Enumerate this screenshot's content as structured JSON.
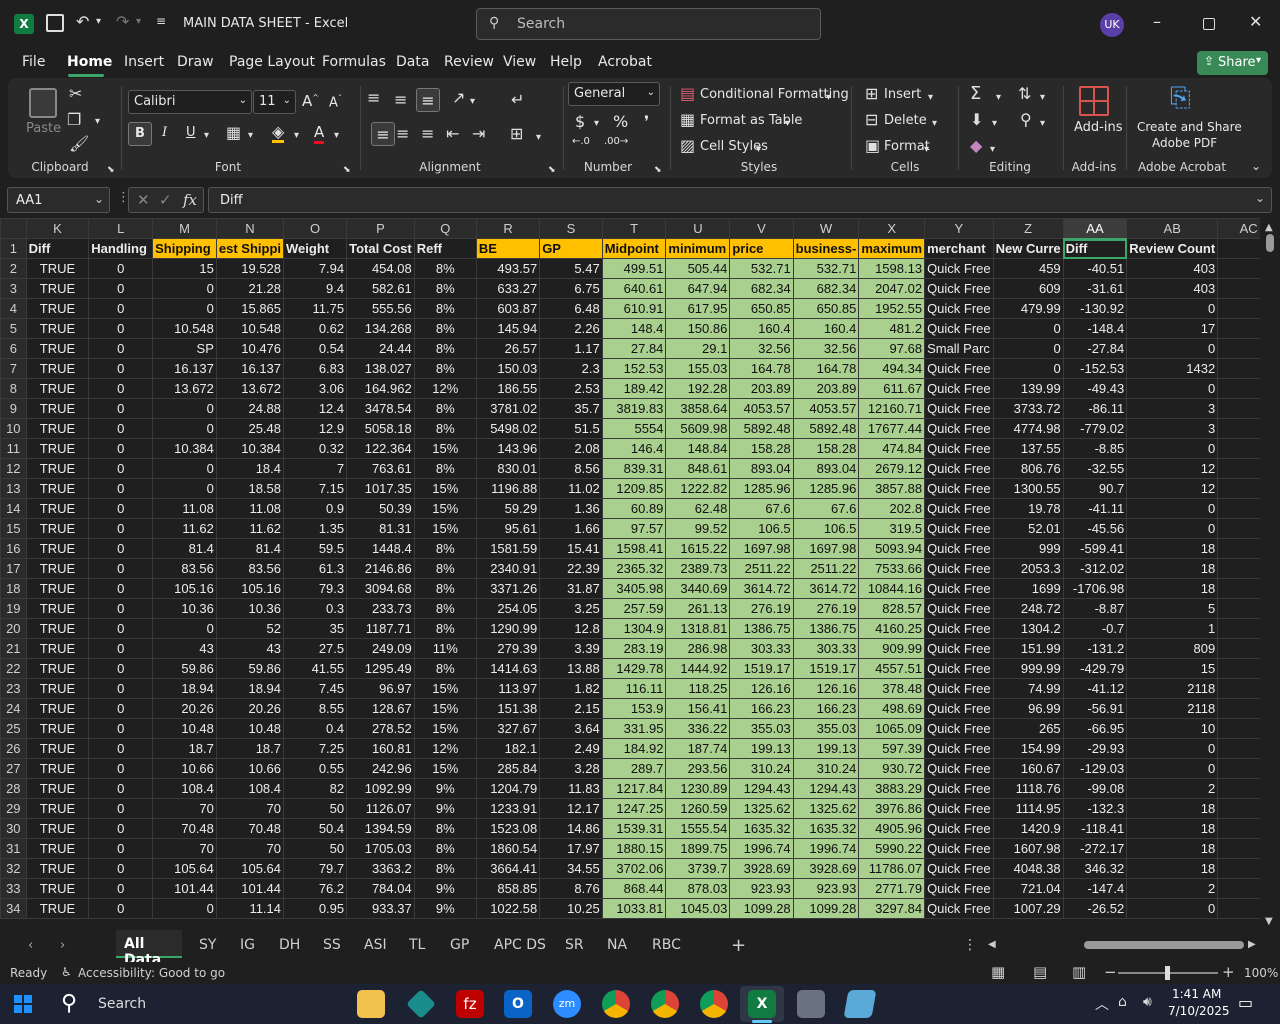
{
  "window": {
    "title": "MAIN DATA SHEET  -  Excel",
    "search_placeholder": "Search",
    "user_initials": "UK"
  },
  "menu": [
    "File",
    "Home",
    "Insert",
    "Draw",
    "Page Layout",
    "Formulas",
    "Data",
    "Review",
    "View",
    "Help",
    "Acrobat"
  ],
  "share_label": "Share",
  "ribbon": {
    "clipboard": {
      "label": "Clipboard",
      "paste": "Paste"
    },
    "font": {
      "label": "Font",
      "family": "Calibri",
      "size": "11"
    },
    "alignment": {
      "label": "Alignment"
    },
    "number": {
      "label": "Number",
      "format": "General"
    },
    "styles": {
      "label": "Styles",
      "cond": "Conditional Formatting",
      "table": "Format as Table",
      "cell": "Cell Styles"
    },
    "cells": {
      "label": "Cells",
      "insert": "Insert",
      "delete": "Delete",
      "format": "Format"
    },
    "editing": {
      "label": "Editing"
    },
    "addins": {
      "label": "Add-ins",
      "btn": "Add-ins"
    },
    "acrobat": {
      "label": "Adobe Acrobat",
      "btn1": "Create and Share",
      "btn2": "Adobe PDF"
    }
  },
  "formula_bar": {
    "name_box": "AA1",
    "formula": "Diff",
    "fx": "fx"
  },
  "columns": [
    "K",
    "L",
    "M",
    "N",
    "O",
    "P",
    "Q",
    "R",
    "S",
    "T",
    "U",
    "V",
    "W",
    "X",
    "Y",
    "Z",
    "AA",
    "AB",
    "AC"
  ],
  "header_row": [
    "Diff",
    "Handling",
    "Shipping",
    "est Shippi",
    "Weight",
    "Total Cost",
    "Reff",
    "BE",
    "GP",
    "Midpoint",
    "minimum",
    "price",
    "business-",
    "maximum",
    "merchant",
    "New Curre",
    "Diff",
    "Review Count",
    ""
  ],
  "rows": [
    [
      "2",
      "TRUE",
      "0",
      "15",
      "19.528",
      "7.94",
      "454.08",
      "8%",
      "493.57",
      "5.47",
      "499.51",
      "505.44",
      "532.71",
      "532.71",
      "1598.13",
      "Quick Free",
      "459",
      "-40.51",
      "403"
    ],
    [
      "3",
      "TRUE",
      "0",
      "0",
      "21.28",
      "9.4",
      "582.61",
      "8%",
      "633.27",
      "6.75",
      "640.61",
      "647.94",
      "682.34",
      "682.34",
      "2047.02",
      "Quick Free",
      "609",
      "-31.61",
      "403"
    ],
    [
      "4",
      "TRUE",
      "0",
      "0",
      "15.865",
      "11.75",
      "555.56",
      "8%",
      "603.87",
      "6.48",
      "610.91",
      "617.95",
      "650.85",
      "650.85",
      "1952.55",
      "Quick Free",
      "479.99",
      "-130.92",
      "0"
    ],
    [
      "5",
      "TRUE",
      "0",
      "10.548",
      "10.548",
      "0.62",
      "134.268",
      "8%",
      "145.94",
      "2.26",
      "148.4",
      "150.86",
      "160.4",
      "160.4",
      "481.2",
      "Quick Free",
      "0",
      "-148.4",
      "17"
    ],
    [
      "6",
      "TRUE",
      "0",
      "SP",
      "10.476",
      "0.54",
      "24.44",
      "8%",
      "26.57",
      "1.17",
      "27.84",
      "29.1",
      "32.56",
      "32.56",
      "97.68",
      "Small Parc",
      "0",
      "-27.84",
      "0"
    ],
    [
      "7",
      "TRUE",
      "0",
      "16.137",
      "16.137",
      "6.83",
      "138.027",
      "8%",
      "150.03",
      "2.3",
      "152.53",
      "155.03",
      "164.78",
      "164.78",
      "494.34",
      "Quick Free",
      "0",
      "-152.53",
      "1432"
    ],
    [
      "8",
      "TRUE",
      "0",
      "13.672",
      "13.672",
      "3.06",
      "164.962",
      "12%",
      "186.55",
      "2.53",
      "189.42",
      "192.28",
      "203.89",
      "203.89",
      "611.67",
      "Quick Free",
      "139.99",
      "-49.43",
      "0"
    ],
    [
      "9",
      "TRUE",
      "0",
      "0",
      "24.88",
      "12.4",
      "3478.54",
      "8%",
      "3781.02",
      "35.7",
      "3819.83",
      "3858.64",
      "4053.57",
      "4053.57",
      "12160.71",
      "Quick Free",
      "3733.72",
      "-86.11",
      "3"
    ],
    [
      "10",
      "TRUE",
      "0",
      "0",
      "25.48",
      "12.9",
      "5058.18",
      "8%",
      "5498.02",
      "51.5",
      "5554",
      "5609.98",
      "5892.48",
      "5892.48",
      "17677.44",
      "Quick Free",
      "4774.98",
      "-779.02",
      "3"
    ],
    [
      "11",
      "TRUE",
      "0",
      "10.384",
      "10.384",
      "0.32",
      "122.364",
      "15%",
      "143.96",
      "2.08",
      "146.4",
      "148.84",
      "158.28",
      "158.28",
      "474.84",
      "Quick Free",
      "137.55",
      "-8.85",
      "0"
    ],
    [
      "12",
      "TRUE",
      "0",
      "0",
      "18.4",
      "7",
      "763.61",
      "8%",
      "830.01",
      "8.56",
      "839.31",
      "848.61",
      "893.04",
      "893.04",
      "2679.12",
      "Quick Free",
      "806.76",
      "-32.55",
      "12"
    ],
    [
      "13",
      "TRUE",
      "0",
      "0",
      "18.58",
      "7.15",
      "1017.35",
      "15%",
      "1196.88",
      "11.02",
      "1209.85",
      "1222.82",
      "1285.96",
      "1285.96",
      "3857.88",
      "Quick Free",
      "1300.55",
      "90.7",
      "12"
    ],
    [
      "14",
      "TRUE",
      "0",
      "11.08",
      "11.08",
      "0.9",
      "50.39",
      "15%",
      "59.29",
      "1.36",
      "60.89",
      "62.48",
      "67.6",
      "67.6",
      "202.8",
      "Quick Free",
      "19.78",
      "-41.11",
      "0"
    ],
    [
      "15",
      "TRUE",
      "0",
      "11.62",
      "11.62",
      "1.35",
      "81.31",
      "15%",
      "95.61",
      "1.66",
      "97.57",
      "99.52",
      "106.5",
      "106.5",
      "319.5",
      "Quick Free",
      "52.01",
      "-45.56",
      "0"
    ],
    [
      "16",
      "TRUE",
      "0",
      "81.4",
      "81.4",
      "59.5",
      "1448.4",
      "8%",
      "1581.59",
      "15.41",
      "1598.41",
      "1615.22",
      "1697.98",
      "1697.98",
      "5093.94",
      "Quick Free",
      "999",
      "-599.41",
      "18"
    ],
    [
      "17",
      "TRUE",
      "0",
      "83.56",
      "83.56",
      "61.3",
      "2146.86",
      "8%",
      "2340.91",
      "22.39",
      "2365.32",
      "2389.73",
      "2511.22",
      "2511.22",
      "7533.66",
      "Quick Free",
      "2053.3",
      "-312.02",
      "18"
    ],
    [
      "18",
      "TRUE",
      "0",
      "105.16",
      "105.16",
      "79.3",
      "3094.68",
      "8%",
      "3371.26",
      "31.87",
      "3405.98",
      "3440.69",
      "3614.72",
      "3614.72",
      "10844.16",
      "Quick Free",
      "1699",
      "-1706.98",
      "18"
    ],
    [
      "19",
      "TRUE",
      "0",
      "10.36",
      "10.36",
      "0.3",
      "233.73",
      "8%",
      "254.05",
      "3.25",
      "257.59",
      "261.13",
      "276.19",
      "276.19",
      "828.57",
      "Quick Free",
      "248.72",
      "-8.87",
      "5"
    ],
    [
      "20",
      "TRUE",
      "0",
      "0",
      "52",
      "35",
      "1187.71",
      "8%",
      "1290.99",
      "12.8",
      "1304.9",
      "1318.81",
      "1386.75",
      "1386.75",
      "4160.25",
      "Quick Free",
      "1304.2",
      "-0.7",
      "1"
    ],
    [
      "21",
      "TRUE",
      "0",
      "43",
      "43",
      "27.5",
      "249.09",
      "11%",
      "279.39",
      "3.39",
      "283.19",
      "286.98",
      "303.33",
      "303.33",
      "909.99",
      "Quick Free",
      "151.99",
      "-131.2",
      "809"
    ],
    [
      "22",
      "TRUE",
      "0",
      "59.86",
      "59.86",
      "41.55",
      "1295.49",
      "8%",
      "1414.63",
      "13.88",
      "1429.78",
      "1444.92",
      "1519.17",
      "1519.17",
      "4557.51",
      "Quick Free",
      "999.99",
      "-429.79",
      "15"
    ],
    [
      "23",
      "TRUE",
      "0",
      "18.94",
      "18.94",
      "7.45",
      "96.97",
      "15%",
      "113.97",
      "1.82",
      "116.11",
      "118.25",
      "126.16",
      "126.16",
      "378.48",
      "Quick Free",
      "74.99",
      "-41.12",
      "2118"
    ],
    [
      "24",
      "TRUE",
      "0",
      "20.26",
      "20.26",
      "8.55",
      "128.67",
      "15%",
      "151.38",
      "2.15",
      "153.9",
      "156.41",
      "166.23",
      "166.23",
      "498.69",
      "Quick Free",
      "96.99",
      "-56.91",
      "2118"
    ],
    [
      "25",
      "TRUE",
      "0",
      "10.48",
      "10.48",
      "0.4",
      "278.52",
      "15%",
      "327.67",
      "3.64",
      "331.95",
      "336.22",
      "355.03",
      "355.03",
      "1065.09",
      "Quick Free",
      "265",
      "-66.95",
      "10"
    ],
    [
      "26",
      "TRUE",
      "0",
      "18.7",
      "18.7",
      "7.25",
      "160.81",
      "12%",
      "182.1",
      "2.49",
      "184.92",
      "187.74",
      "199.13",
      "199.13",
      "597.39",
      "Quick Free",
      "154.99",
      "-29.93",
      "0"
    ],
    [
      "27",
      "TRUE",
      "0",
      "10.66",
      "10.66",
      "0.55",
      "242.96",
      "15%",
      "285.84",
      "3.28",
      "289.7",
      "293.56",
      "310.24",
      "310.24",
      "930.72",
      "Quick Free",
      "160.67",
      "-129.03",
      "0"
    ],
    [
      "28",
      "TRUE",
      "0",
      "108.4",
      "108.4",
      "82",
      "1092.99",
      "9%",
      "1204.79",
      "11.83",
      "1217.84",
      "1230.89",
      "1294.43",
      "1294.43",
      "3883.29",
      "Quick Free",
      "1118.76",
      "-99.08",
      "2"
    ],
    [
      "29",
      "TRUE",
      "0",
      "70",
      "70",
      "50",
      "1126.07",
      "9%",
      "1233.91",
      "12.17",
      "1247.25",
      "1260.59",
      "1325.62",
      "1325.62",
      "3976.86",
      "Quick Free",
      "1114.95",
      "-132.3",
      "18"
    ],
    [
      "30",
      "TRUE",
      "0",
      "70.48",
      "70.48",
      "50.4",
      "1394.59",
      "8%",
      "1523.08",
      "14.86",
      "1539.31",
      "1555.54",
      "1635.32",
      "1635.32",
      "4905.96",
      "Quick Free",
      "1420.9",
      "-118.41",
      "18"
    ],
    [
      "31",
      "TRUE",
      "0",
      "70",
      "70",
      "50",
      "1705.03",
      "8%",
      "1860.54",
      "17.97",
      "1880.15",
      "1899.75",
      "1996.74",
      "1996.74",
      "5990.22",
      "Quick Free",
      "1607.98",
      "-272.17",
      "18"
    ],
    [
      "32",
      "TRUE",
      "0",
      "105.64",
      "105.64",
      "79.7",
      "3363.2",
      "8%",
      "3664.41",
      "34.55",
      "3702.06",
      "3739.7",
      "3928.69",
      "3928.69",
      "11786.07",
      "Quick Free",
      "4048.38",
      "346.32",
      "18"
    ],
    [
      "33",
      "TRUE",
      "0",
      "101.44",
      "101.44",
      "76.2",
      "784.04",
      "9%",
      "858.85",
      "8.76",
      "868.44",
      "878.03",
      "923.93",
      "923.93",
      "2771.79",
      "Quick Free",
      "721.04",
      "-147.4",
      "2"
    ],
    [
      "34",
      "TRUE",
      "0",
      "0",
      "11.14",
      "0.95",
      "933.37",
      "9%",
      "1022.58",
      "10.25",
      "1033.81",
      "1045.03",
      "1099.28",
      "1099.28",
      "3297.84",
      "Quick Free",
      "1007.29",
      "-26.52",
      "0"
    ]
  ],
  "sheet_tabs": [
    "All Data",
    "SY",
    "IG",
    "DH",
    "SS",
    "ASI",
    "TL",
    "GP",
    "APC DS",
    "SR",
    "NA",
    "RBC"
  ],
  "status": {
    "ready": "Ready",
    "accessibility": "Accessibility: Good to go",
    "zoom": "100%"
  },
  "taskbar": {
    "search": "Search",
    "time": "1:41 AM",
    "date": "7/10/2025"
  }
}
